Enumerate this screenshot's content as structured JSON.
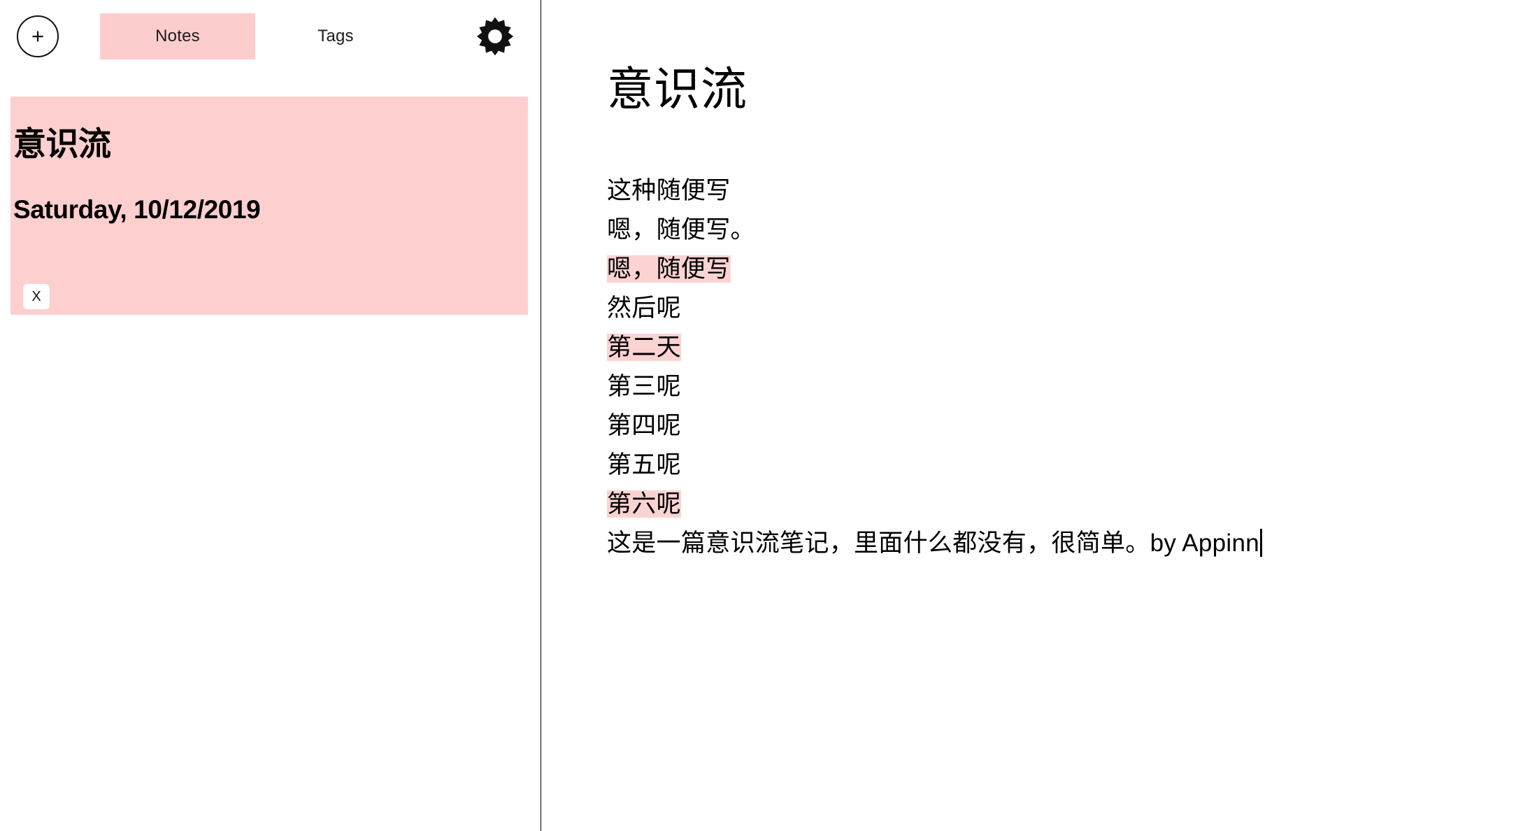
{
  "sidebar": {
    "add_button": {
      "label": "+",
      "icon": "plus-icon"
    },
    "tabs": [
      {
        "label": "Notes",
        "active": true
      },
      {
        "label": "Tags",
        "active": false
      }
    ],
    "settings_button": {
      "icon": "gear-icon"
    },
    "notes": [
      {
        "title": "意识流",
        "date": "Saturday, 10/12/2019",
        "delete_label": "X",
        "selected": true
      }
    ]
  },
  "editor": {
    "title": "意识流",
    "lines": [
      {
        "segments": [
          {
            "text": "这种随便写",
            "highlight": false
          }
        ]
      },
      {
        "segments": [
          {
            "text": "嗯，随便写。",
            "highlight": false
          }
        ]
      },
      {
        "segments": [
          {
            "text": "嗯，随便写",
            "highlight": true
          }
        ]
      },
      {
        "segments": [
          {
            "text": "然后呢",
            "highlight": false
          }
        ]
      },
      {
        "segments": [
          {
            "text": "第二天",
            "highlight": true
          }
        ]
      },
      {
        "segments": [
          {
            "text": "第三呢",
            "highlight": false
          }
        ]
      },
      {
        "segments": [
          {
            "text": "第四呢",
            "highlight": false
          }
        ]
      },
      {
        "segments": [
          {
            "text": "第五呢",
            "highlight": false
          }
        ]
      },
      {
        "segments": [
          {
            "text": "第六呢",
            "highlight": true
          }
        ]
      },
      {
        "segments": [
          {
            "text": "这是一篇意识流笔记，里面什么都没有，很简单。by Appinn",
            "highlight": false
          }
        ],
        "caret": true
      }
    ]
  },
  "colors": {
    "accent_pink": "#fdcdcd",
    "card_pink": "#fdcfcf",
    "highlight_pink": "#fbd3d3",
    "ink": "#000000",
    "background": "#ffffff"
  }
}
